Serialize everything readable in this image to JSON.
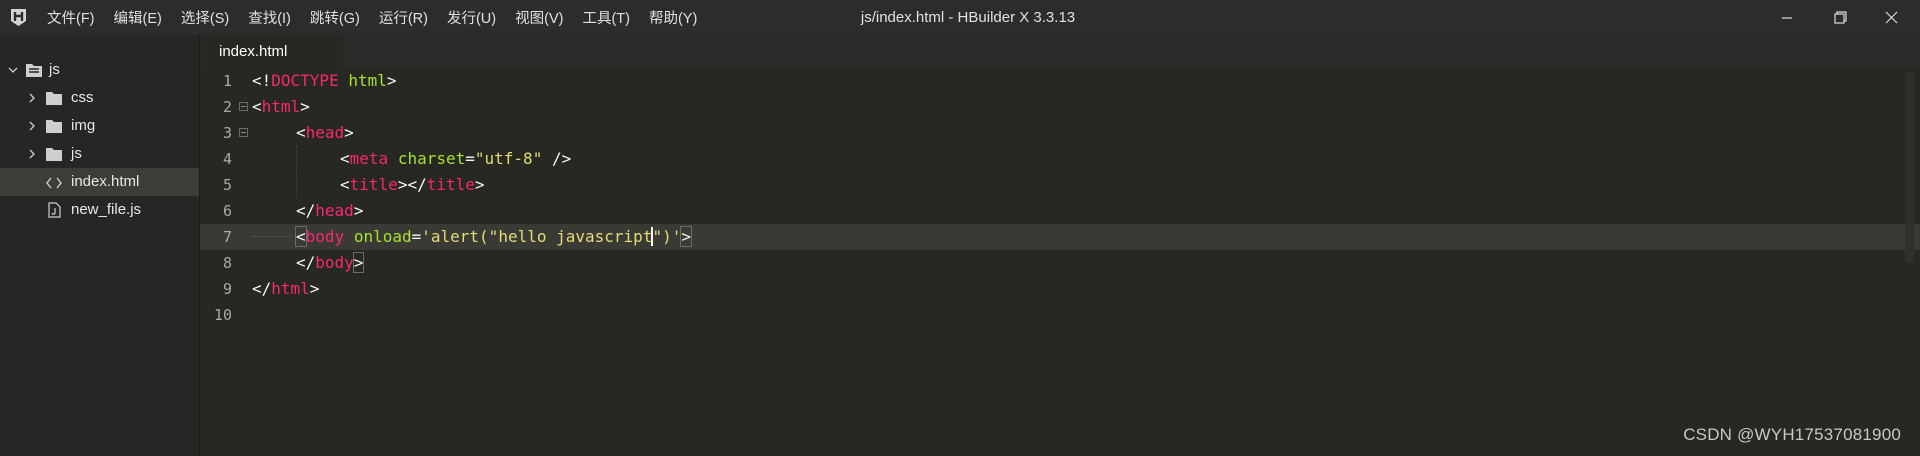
{
  "app": {
    "window_title": "js/index.html - HBuilder X 3.3.13",
    "menu": [
      "文件(F)",
      "编辑(E)",
      "选择(S)",
      "查找(I)",
      "跳转(G)",
      "运行(R)",
      "发行(U)",
      "视图(V)",
      "工具(T)",
      "帮助(Y)"
    ]
  },
  "sidebar": {
    "root": "js",
    "items": [
      {
        "label": "css",
        "kind": "folder"
      },
      {
        "label": "img",
        "kind": "folder"
      },
      {
        "label": "js",
        "kind": "folder"
      },
      {
        "label": "index.html",
        "kind": "html-file",
        "selected": true
      },
      {
        "label": "new_file.js",
        "kind": "js-file"
      }
    ]
  },
  "editor": {
    "active_tab": "index.html",
    "line_numbers": [
      "1",
      "2",
      "3",
      "4",
      "5",
      "6",
      "7",
      "8",
      "9",
      "10"
    ],
    "current_line": 7,
    "code": {
      "l1": [
        "<!",
        "DOCTYPE",
        " ",
        "html",
        ">"
      ],
      "l2": [
        "<",
        "html",
        ">"
      ],
      "l3": [
        "<",
        "head",
        ">"
      ],
      "l4": [
        "<",
        "meta",
        " ",
        "charset",
        "=",
        "\"utf-8\"",
        " />"
      ],
      "l5": [
        "<",
        "title",
        "></",
        "title",
        ">"
      ],
      "l6": [
        "</",
        "head",
        ">"
      ],
      "l7": [
        "<",
        "body",
        " ",
        "onload",
        "=",
        "'alert(\"hello javascript",
        "\")'",
        ">"
      ],
      "l8": [
        "</",
        "body",
        ">"
      ],
      "l9": [
        "</",
        "html",
        ">"
      ]
    }
  },
  "watermark": "CSDN @WYH17537081900",
  "colors": {
    "tag": "#f92672",
    "attribute": "#a6e22e",
    "string": "#e6db74",
    "background": "#272822",
    "current_line": "#3a3a35"
  }
}
